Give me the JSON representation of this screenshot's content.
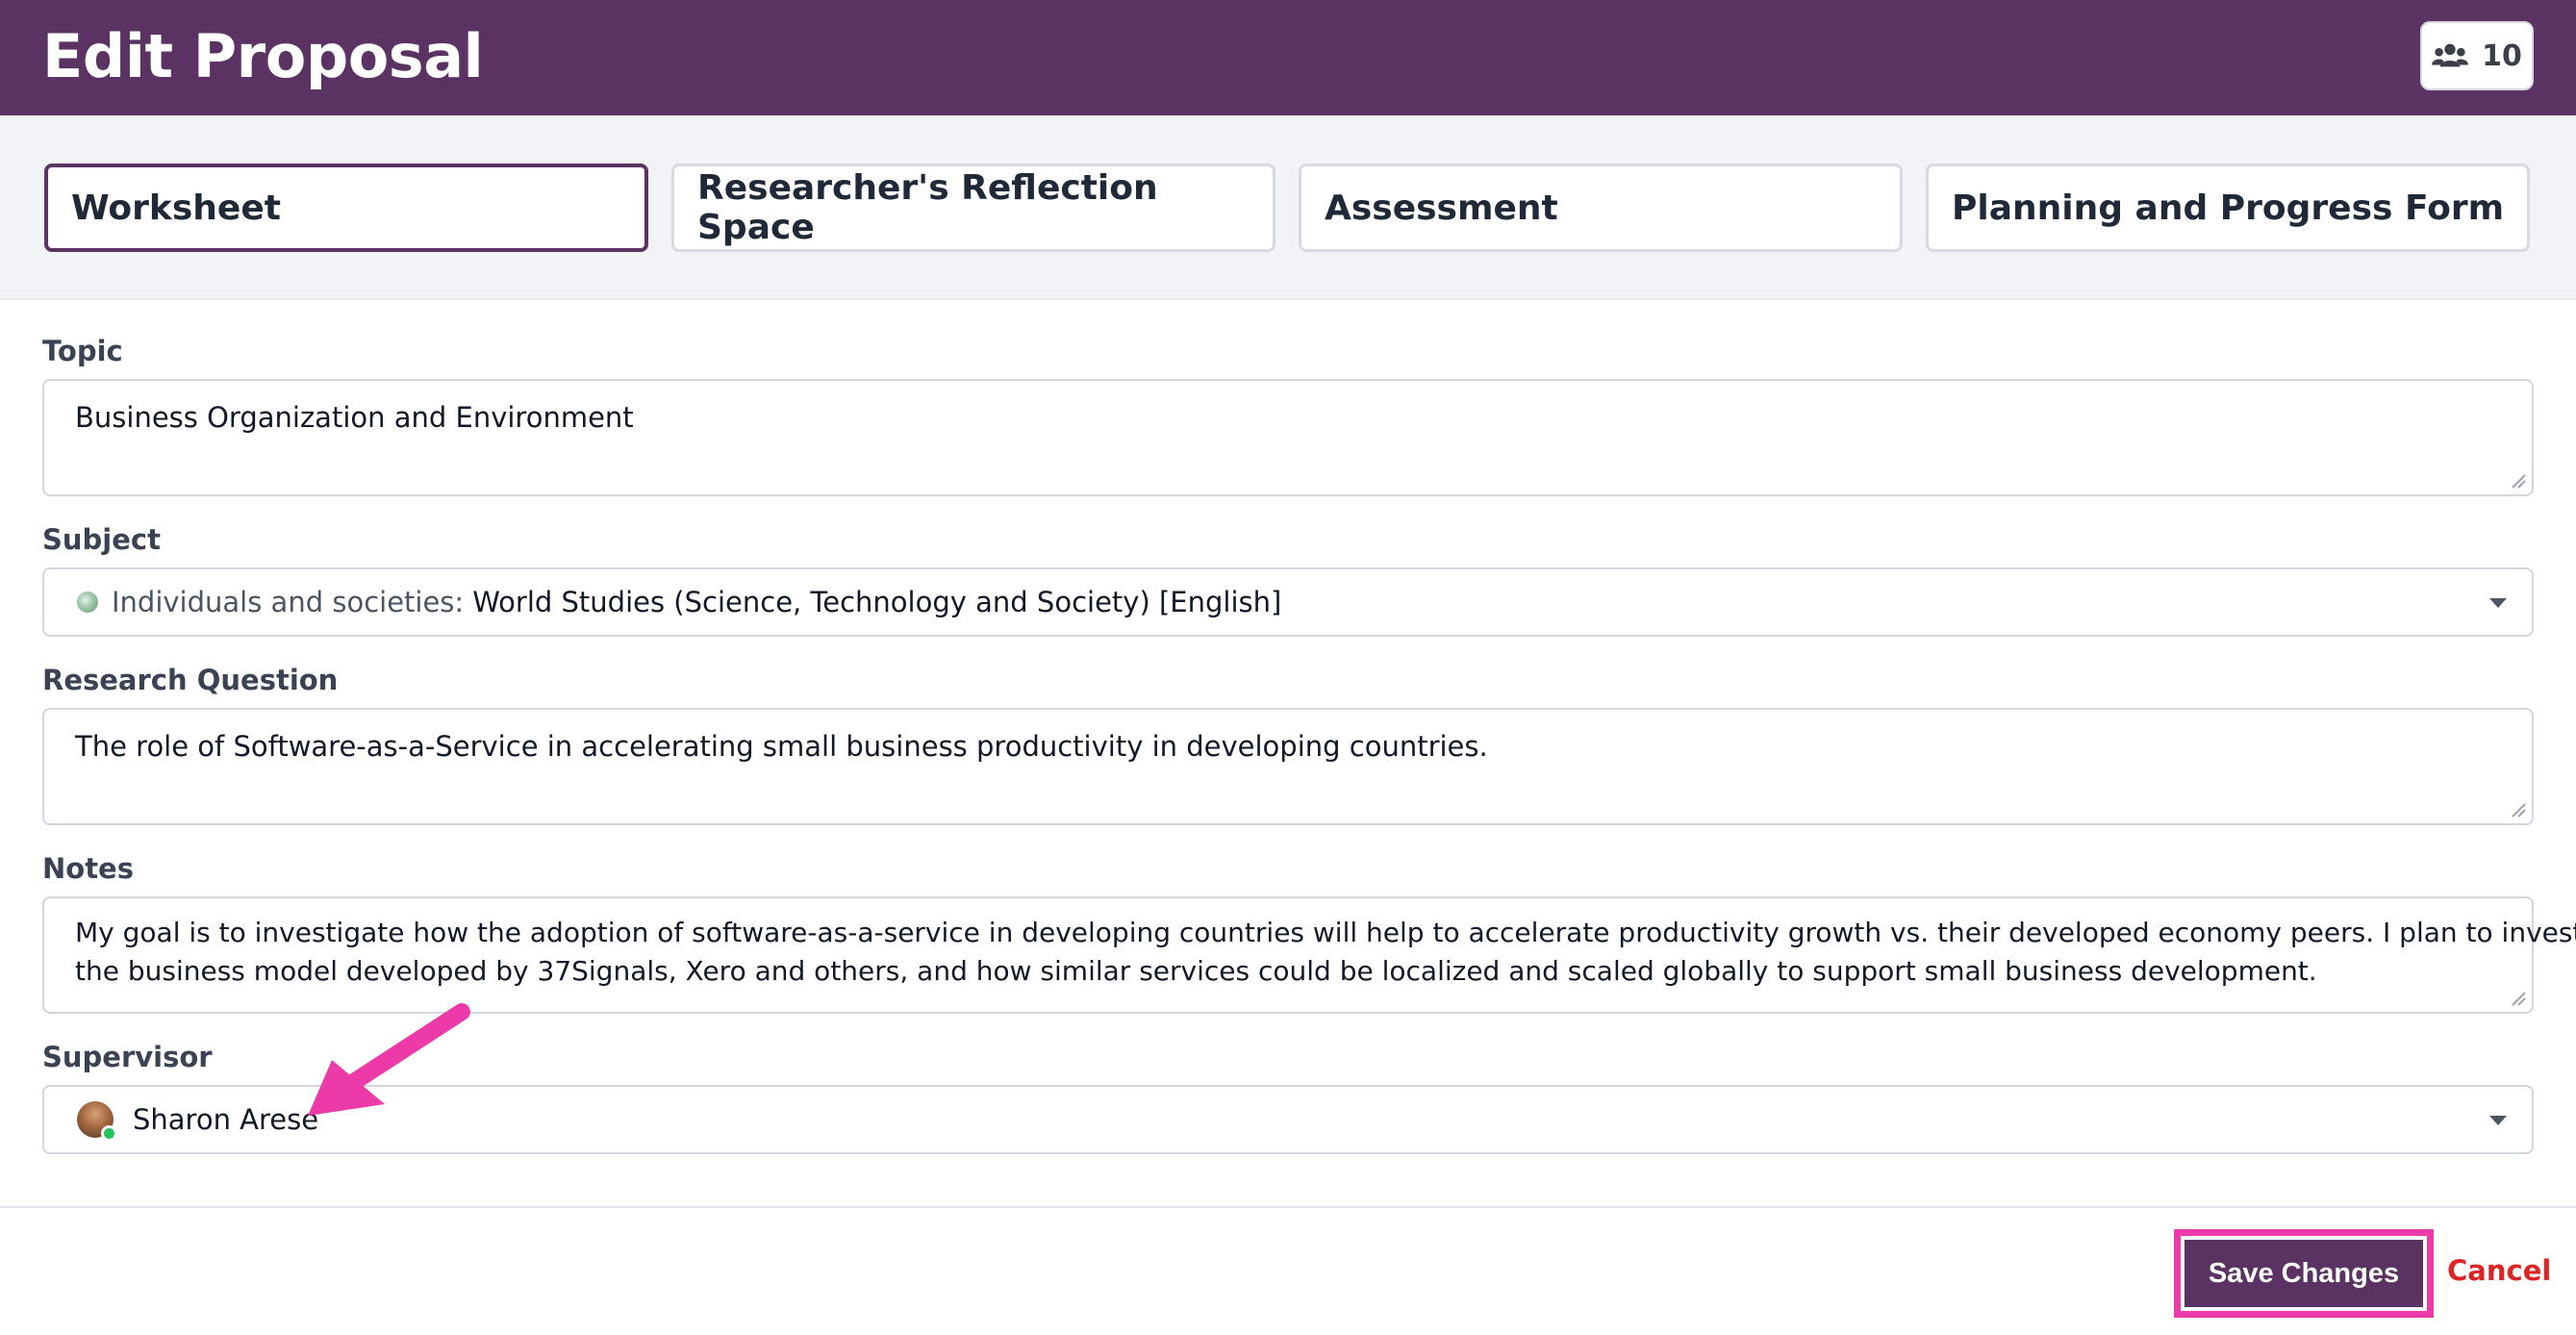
{
  "header": {
    "title": "Edit Proposal",
    "members_count": "10",
    "members_icon": "users-icon"
  },
  "tabs": [
    {
      "label": "Worksheet",
      "active": true
    },
    {
      "label": "Researcher's Reflection Space",
      "active": false
    },
    {
      "label": "Assessment",
      "active": false
    },
    {
      "label": "Planning and Progress Form",
      "active": false
    }
  ],
  "form": {
    "topic": {
      "label": "Topic",
      "value": "Business Organization and Environment"
    },
    "subject": {
      "label": "Subject",
      "group": "Individuals and societies:",
      "value": "World Studies (Science, Technology and Society) [English]"
    },
    "research_question": {
      "label": "Research Question",
      "value": "The role of Software-as-a-Service in accelerating small business productivity in developing countries."
    },
    "notes": {
      "label": "Notes",
      "value_line1": "My goal is to investigate how the adoption of software-as-a-service in developing countries will help to accelerate productivity growth vs. their developed economy peers. I plan to investigate",
      "value_line2": "the business model developed by 37Signals, Xero and others, and how similar services could be localized and scaled globally to support small business development."
    },
    "supervisor": {
      "label": "Supervisor",
      "value": "Sharon Arese",
      "status": "online"
    }
  },
  "footer": {
    "save_label": "Save Changes",
    "cancel_label": "Cancel"
  },
  "colors": {
    "brand": "#5b3362",
    "highlight": "#ec3ba8",
    "cancel": "#dc2626",
    "online": "#22c55e"
  }
}
